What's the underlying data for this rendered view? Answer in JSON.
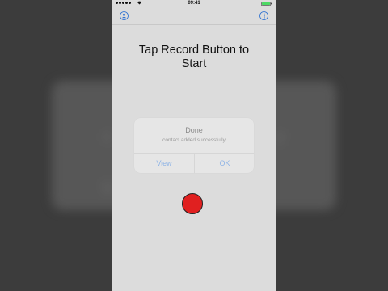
{
  "status_bar": {
    "carrier": "",
    "time": "09:41"
  },
  "icons": {
    "contact": "person-circle-icon",
    "info": "info-circle-icon",
    "wifi": "wifi-icon",
    "battery": "battery-icon"
  },
  "main": {
    "prompt": "Tap Record Button to Start",
    "record_color": "#e02020"
  },
  "alert": {
    "title": "Done",
    "message": "contact added successfully",
    "buttons": [
      "View",
      "OK"
    ]
  },
  "colors": {
    "accent": "#8fb4e6",
    "background": "#dcdcdc",
    "record": "#e02020"
  }
}
